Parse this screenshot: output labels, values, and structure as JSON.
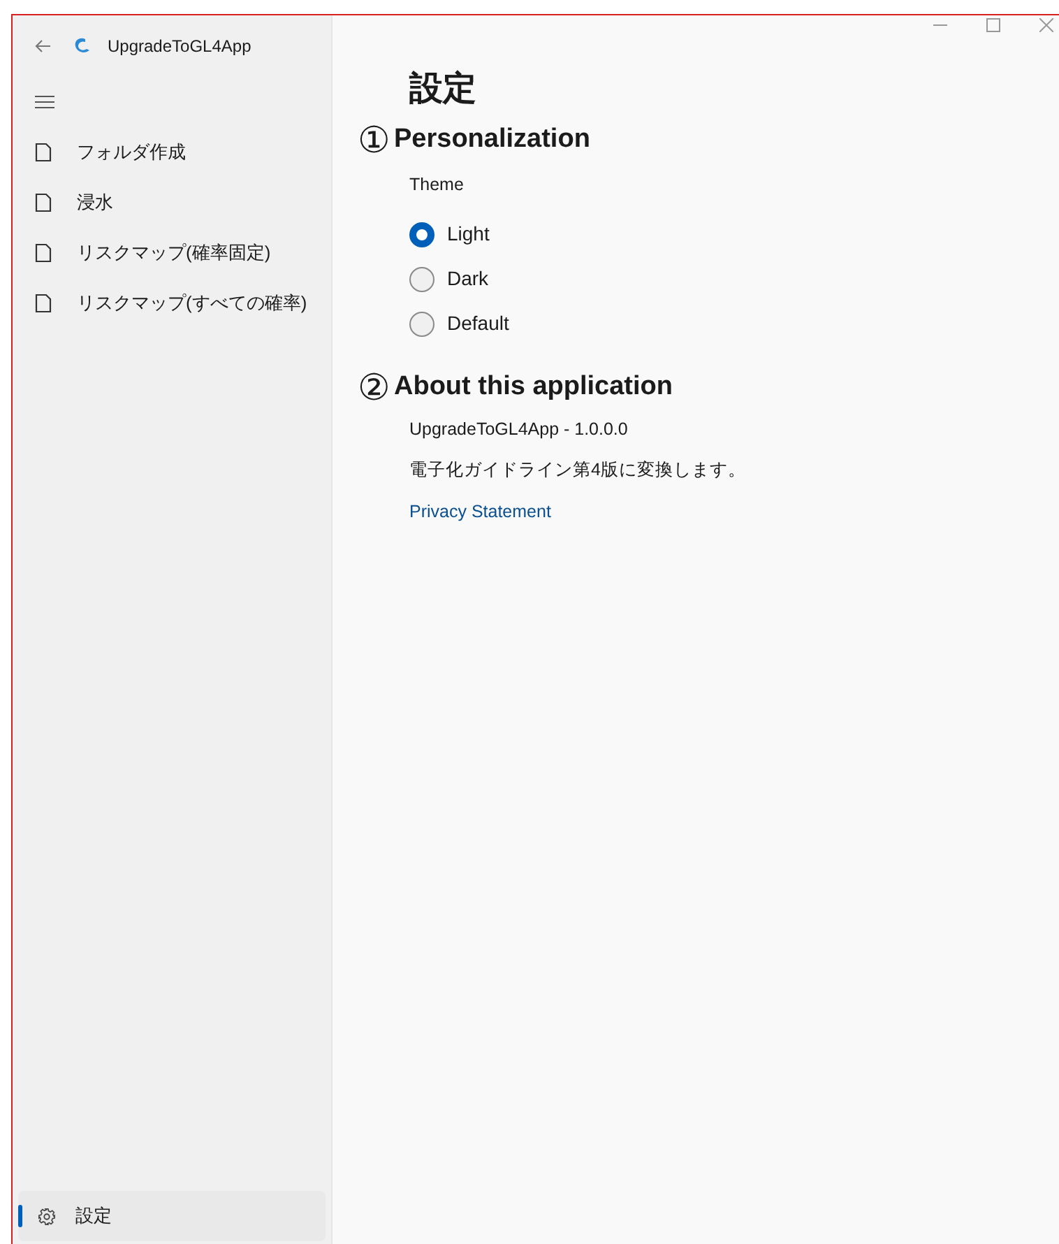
{
  "window": {
    "title": "UpgradeToGL4App"
  },
  "nav": {
    "items": [
      {
        "label": "フォルダ作成",
        "selected": false
      },
      {
        "label": "浸水",
        "selected": false
      },
      {
        "label": "リスクマップ(確率固定)",
        "selected": false
      },
      {
        "label": "リスクマップ(すべての確率)",
        "selected": false
      }
    ],
    "footer": {
      "label": "設定",
      "selected": true
    }
  },
  "page": {
    "title": "設定",
    "sections": [
      {
        "marker": "①",
        "heading": "Personalization",
        "kind": "theme",
        "label": "Theme",
        "options": [
          {
            "label": "Light",
            "selected": true
          },
          {
            "label": "Dark",
            "selected": false
          },
          {
            "label": "Default",
            "selected": false
          }
        ]
      },
      {
        "marker": "②",
        "heading": "About this application",
        "kind": "about",
        "version": "UpgradeToGL4App - 1.0.0.0",
        "description": "電子化ガイドライン第4版に変換します。",
        "link": "Privacy Statement"
      }
    ]
  }
}
